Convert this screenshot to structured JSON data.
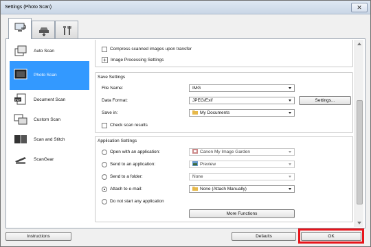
{
  "window": {
    "title": "Settings (Photo Scan)"
  },
  "tabs": [
    {
      "label": "scan-from-computer",
      "icon": "computer-scan-icon"
    },
    {
      "label": "scan-from-panel",
      "icon": "scanner-icon"
    },
    {
      "label": "general-settings",
      "icon": "tools-icon"
    }
  ],
  "sidebar": {
    "items": [
      {
        "label": "Auto Scan"
      },
      {
        "label": "Photo Scan"
      },
      {
        "label": "Document Scan"
      },
      {
        "label": "Custom Scan"
      },
      {
        "label": "Scan and Stitch"
      },
      {
        "label": "ScanGear"
      }
    ]
  },
  "image_processing": {
    "compress_label": "Compress scanned images upon transfer",
    "settings_label": "Image Processing Settings"
  },
  "save_settings": {
    "title": "Save Settings",
    "file_name_label": "File Name:",
    "file_name_value": "IMG",
    "data_format_label": "Data Format:",
    "data_format_value": "JPEG/Exif",
    "settings_button": "Settings...",
    "save_in_label": "Save in:",
    "save_in_value": "My Documents",
    "check_results_label": "Check scan results"
  },
  "app_settings": {
    "title": "Application Settings",
    "open_label": "Open with an application:",
    "open_value": "Canon My Image Garden",
    "send_app_label": "Send to an application:",
    "send_app_value": "Preview",
    "send_folder_label": "Send to a folder:",
    "send_folder_value": "None",
    "attach_label": "Attach to e-mail:",
    "attach_value": "None (Attach Manually)",
    "no_start_label": "Do not start any application",
    "more_functions": "More Functions"
  },
  "footer": {
    "instructions": "Instructions",
    "defaults": "Defaults",
    "ok": "OK"
  },
  "colors": {
    "selected": "#3399ff",
    "highlight": "#e8141a"
  }
}
